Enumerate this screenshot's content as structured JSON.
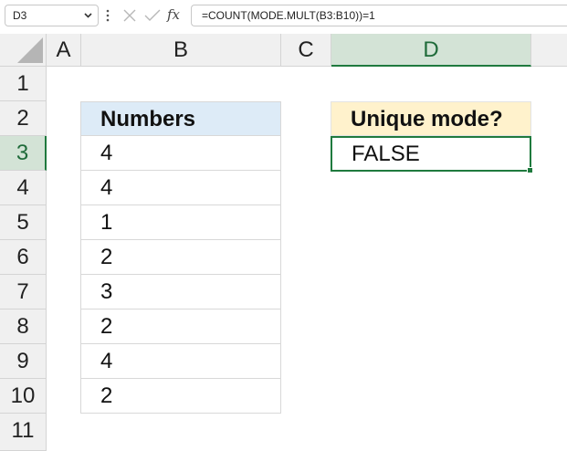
{
  "formula_bar": {
    "name_box": "D3",
    "formula": "=COUNT(MODE.MULT(B3:B10))=1",
    "fx_label": "fx",
    "icons": [
      "chevron-down-icon",
      "more-options-icon",
      "cancel-icon",
      "enter-icon",
      "insert-function-icon"
    ]
  },
  "columns": [
    "A",
    "B",
    "C",
    "D"
  ],
  "selected_column": "D",
  "rows": [
    "1",
    "2",
    "3",
    "4",
    "5",
    "6",
    "7",
    "8",
    "9",
    "10",
    "11"
  ],
  "selected_row": "3",
  "table": {
    "header": "Numbers",
    "values": [
      "4",
      "4",
      "1",
      "2",
      "3",
      "2",
      "4",
      "2"
    ]
  },
  "result": {
    "header": "Unique mode?",
    "value": "FALSE"
  },
  "colors": {
    "table_header_bg": "#ddebf7",
    "result_header_bg": "#fff2cc",
    "selection_green": "#1f7a3e",
    "header_bg": "#f0f0f0"
  }
}
